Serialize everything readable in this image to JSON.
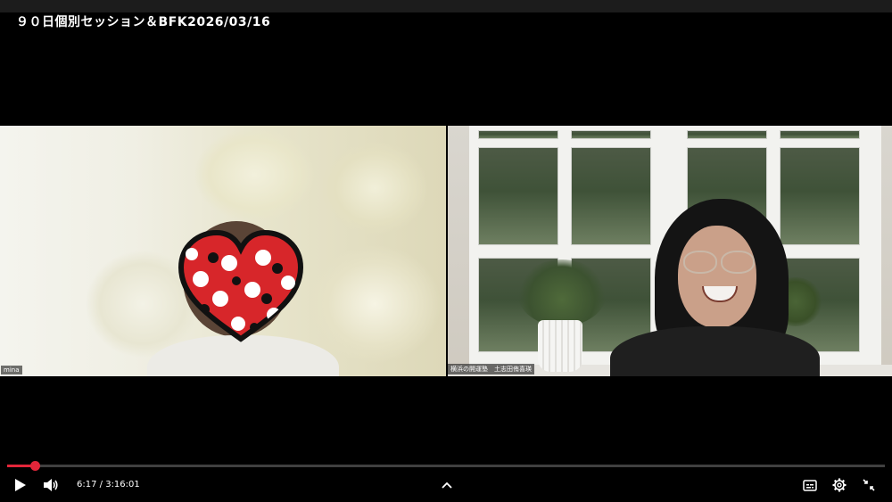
{
  "video": {
    "title": "９０日個別セッション＆BFK2026/03/16"
  },
  "participants": [
    {
      "name": "mina"
    },
    {
      "name": "横浜の開運塾　土志田侑喜瑛"
    }
  ],
  "player": {
    "current_time": "6:17",
    "duration": "3:16:01",
    "separator": " / ",
    "progress_fraction": 0.032,
    "accent_color": "#e3263a",
    "icons": {
      "play": "play-icon",
      "volume": "volume-icon",
      "expand": "chevron-up-icon",
      "captions": "captions-icon",
      "settings": "gear-icon",
      "fullscreen_exit": "exit-fullscreen-icon"
    }
  }
}
